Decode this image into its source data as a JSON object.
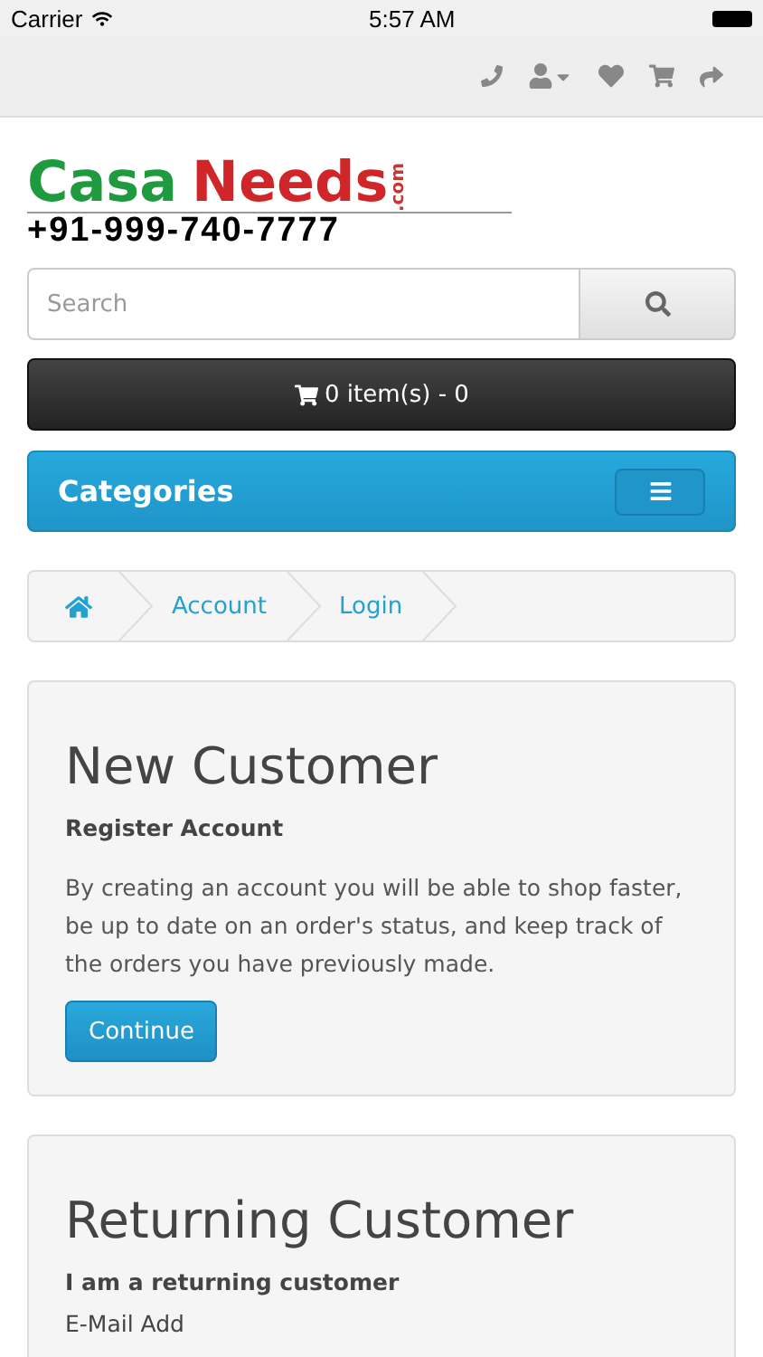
{
  "status_bar": {
    "carrier": "Carrier",
    "time": "5:57 AM"
  },
  "logo": {
    "word_1": "Casa",
    "word_2": "Needs",
    "suffix": ".com",
    "phone": "+91-999-740-7777"
  },
  "search": {
    "placeholder": "Search"
  },
  "cart": {
    "label": "0 item(s) - 0"
  },
  "categories": {
    "title": "Categories"
  },
  "breadcrumb": [
    "Account",
    "Login"
  ],
  "new_customer": {
    "title": "New Customer",
    "subtitle": "Register Account",
    "text": "By creating an account you will be able to shop faster, be up to date on an order's status, and keep track of the orders you have previously made.",
    "button": "Continue"
  },
  "returning_customer": {
    "title": "Returning Customer",
    "subtitle": "I am a returning customer",
    "field_label": "E-Mail Add"
  }
}
